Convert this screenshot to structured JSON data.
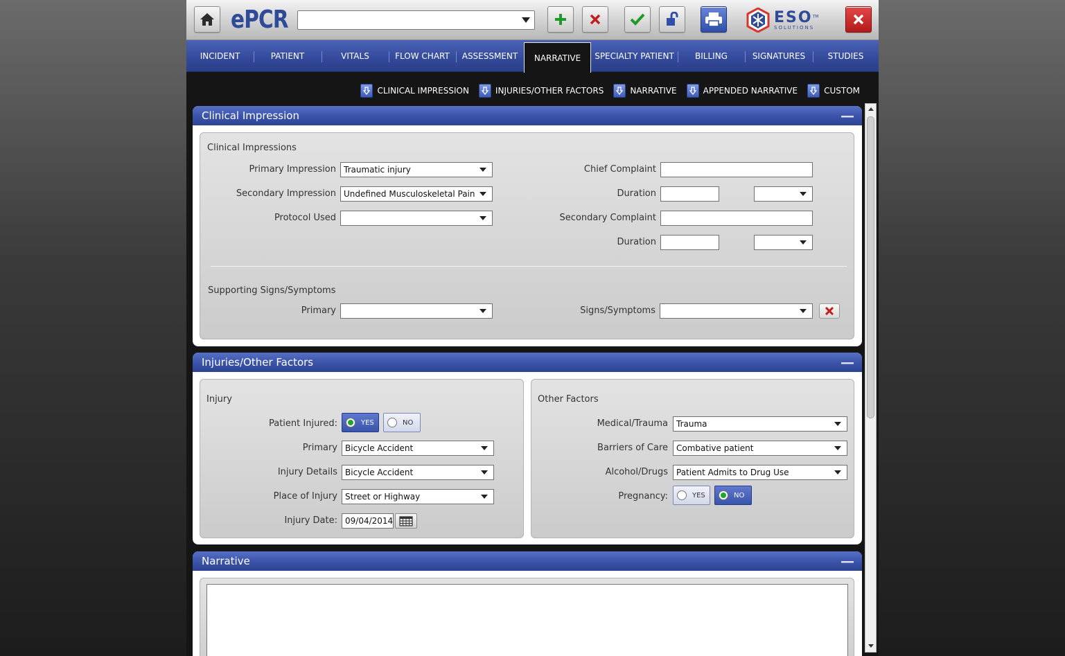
{
  "toolbar": {
    "app_logo": "ePCR",
    "record_select_value": "",
    "brand_logo_big": "ESO",
    "brand_logo_small": "SOLUTIONS",
    "brand_tm": "TM"
  },
  "tabs": [
    {
      "label": "INCIDENT"
    },
    {
      "label": "PATIENT"
    },
    {
      "label": "VITALS"
    },
    {
      "label": "FLOW CHART"
    },
    {
      "label": "ASSESSMENT"
    },
    {
      "label": "NARRATIVE",
      "active": true
    },
    {
      "label": "SPECIALTY PATIENT"
    },
    {
      "label": "BILLING"
    },
    {
      "label": "SIGNATURES"
    },
    {
      "label": "STUDIES"
    }
  ],
  "subnav": [
    {
      "label": "CLINICAL IMPRESSION"
    },
    {
      "label": "INJURIES/OTHER FACTORS"
    },
    {
      "label": "NARRATIVE"
    },
    {
      "label": "APPENDED NARRATIVE"
    },
    {
      "label": "CUSTOM"
    }
  ],
  "clinical": {
    "title": "Clinical Impression",
    "section_title": "Clinical Impressions",
    "primary_impression_label": "Primary Impression",
    "primary_impression_value": "Traumatic injury",
    "secondary_impression_label": "Secondary Impression",
    "secondary_impression_value": "Undefined Musculoskeletal Pain",
    "protocol_label": "Protocol Used",
    "protocol_value": "",
    "chief_complaint_label": "Chief Complaint",
    "chief_complaint_value": "",
    "duration_label": "Duration",
    "duration1_value": "",
    "duration1_unit": "",
    "secondary_complaint_label": "Secondary Complaint",
    "secondary_complaint_value": "",
    "duration2_value": "",
    "duration2_unit": "",
    "signs_section_title": "Supporting Signs/Symptoms",
    "signs_primary_label": "Primary",
    "signs_primary_value": "",
    "signs_symptoms_label": "Signs/Symptoms",
    "signs_symptoms_value": ""
  },
  "injuries": {
    "title": "Injuries/Other Factors",
    "injury_title": "Injury",
    "patient_injured_label": "Patient Injured:",
    "yes_label": "YES",
    "no_label": "NO",
    "patient_injured_selected": "YES",
    "primary_label": "Primary",
    "primary_value": "Bicycle Accident",
    "injury_details_label": "Injury Details",
    "injury_details_value": "Bicycle Accident",
    "place_label": "Place of Injury",
    "place_value": "Street or Highway",
    "injury_date_label": "Injury Date:",
    "injury_date_value": "09/04/2014",
    "other_title": "Other Factors",
    "medical_trauma_label": "Medical/Trauma",
    "medical_trauma_value": "Trauma",
    "barriers_label": "Barriers of Care",
    "barriers_value": "Combative patient",
    "alcohol_label": "Alcohol/Drugs",
    "alcohol_value": "Patient Admits to Drug Use",
    "pregnancy_label": "Pregnancy:",
    "pregnancy_selected": "NO"
  },
  "narrative": {
    "title": "Narrative",
    "text": ""
  },
  "colors": {
    "header_blue": "#3a53a8",
    "tab_blue": "#33499a",
    "accept_green": "#1fa52a",
    "cancel_red": "#c21f1f"
  }
}
